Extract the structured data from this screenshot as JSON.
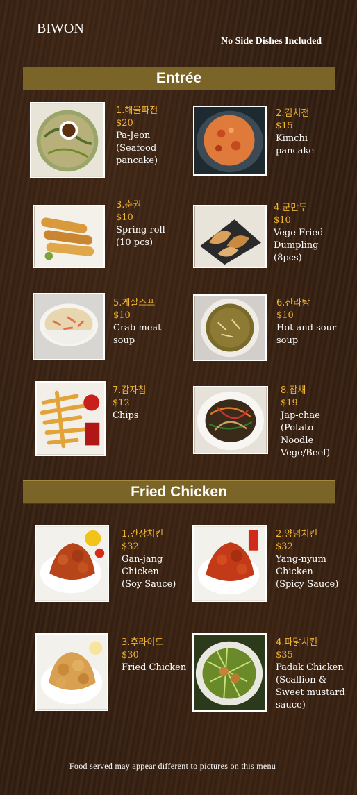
{
  "header": {
    "brand": "BIWON",
    "note": "No Side Dishes Included"
  },
  "sections": {
    "entree": {
      "title": "Entrée",
      "items": [
        {
          "kr": "1.해물파전",
          "price": "$20",
          "desc": [
            "Pa-Jeon",
            "(Seafood",
            "pancake)"
          ]
        },
        {
          "kr": "2.김치전",
          "price": "$15",
          "desc": [
            "Kimchi",
            "pancake"
          ]
        },
        {
          "kr": "3.춘권",
          "price": "$10",
          "desc": [
            "Spring roll",
            "(10 pcs)"
          ]
        },
        {
          "kr": "4.군만두",
          "price": "$10",
          "desc": [
            "Vege Fried",
            "Dumpling",
            "(8pcs)"
          ]
        },
        {
          "kr": "5.게살스프",
          "price": "$10",
          "desc": [
            "Crab meat",
            "soup"
          ]
        },
        {
          "kr": "6.산라탕",
          "price": "$10",
          "desc": [
            "Hot and sour",
            "soup"
          ]
        },
        {
          "kr": "7.감자칩",
          "price": "$12",
          "desc": [
            "Chips"
          ]
        },
        {
          "kr": "8.잡채",
          "price": "$19",
          "desc": [
            "Jap-chae",
            "(Potato",
            "Noodle",
            "Vege/Beef)"
          ]
        }
      ]
    },
    "chicken": {
      "title": "Fried Chicken",
      "items": [
        {
          "kr": "1.간장치킨",
          "price": "$32",
          "desc": [
            "Gan-jang",
            "Chicken",
            "(Soy Sauce)"
          ]
        },
        {
          "kr": "2.양념치킨",
          "price": "$32",
          "desc": [
            "Yang-nyum",
            "Chicken",
            "(Spicy Sauce)"
          ]
        },
        {
          "kr": "3.후라이드",
          "price": "$30",
          "desc": [
            "Fried Chicken"
          ]
        },
        {
          "kr": "4.파닭치킨",
          "price": "$35",
          "desc": [
            "Padak Chicken",
            "(Scallion &",
            "Sweet mustard",
            "sauce)"
          ]
        }
      ]
    }
  },
  "footer": {
    "text": "Food served may appear different  to pictures on this menu"
  }
}
